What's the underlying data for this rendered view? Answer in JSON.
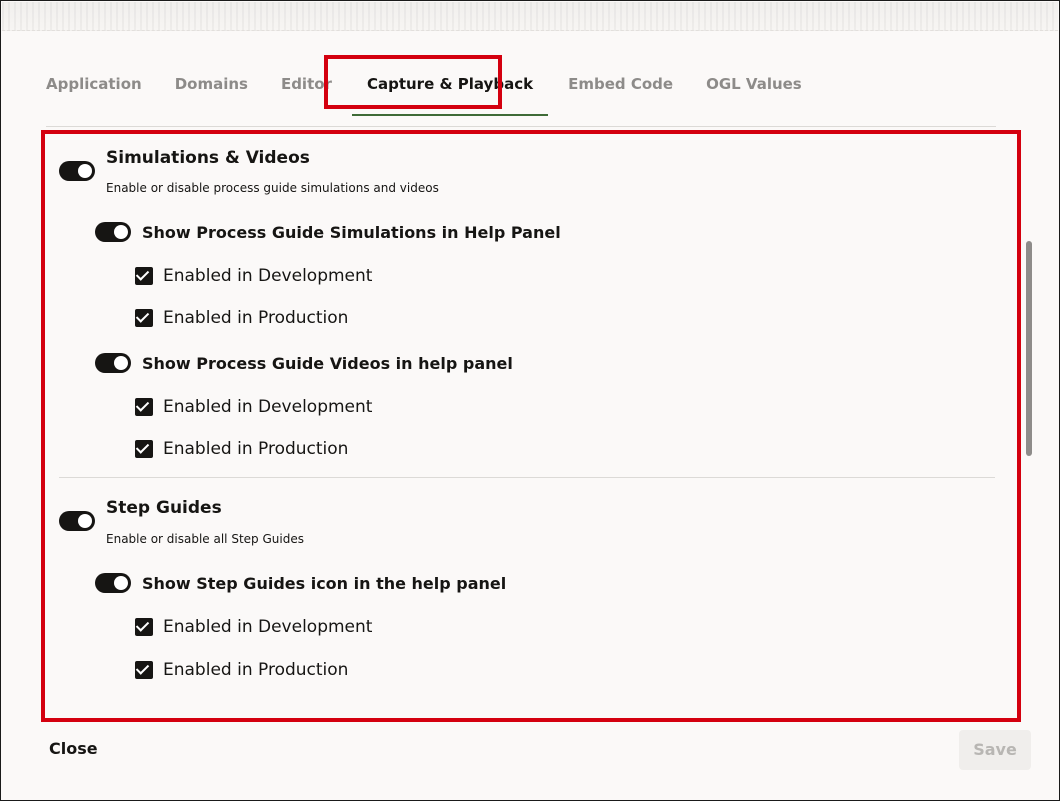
{
  "tabs": [
    {
      "label": "Application"
    },
    {
      "label": "Domains"
    },
    {
      "label": "Editor"
    },
    {
      "label": "Capture & Playback"
    },
    {
      "label": "Embed Code"
    },
    {
      "label": "OGL Values"
    }
  ],
  "active_tab": "Capture & Playback",
  "sections": {
    "simulations": {
      "title": "Simulations & Videos",
      "description": "Enable or disable process guide simulations and videos",
      "enabled": true,
      "simulations_panel": {
        "title": "Show Process Guide Simulations in Help Panel",
        "enabled": true,
        "development_label": "Enabled in Development",
        "development_checked": true,
        "production_label": "Enabled in Production",
        "production_checked": true
      },
      "videos_panel": {
        "title": "Show Process Guide Videos in help panel",
        "enabled": true,
        "development_label": "Enabled in Development",
        "development_checked": true,
        "production_label": "Enabled in Production",
        "production_checked": true
      }
    },
    "step_guides": {
      "title": "Step Guides",
      "description": "Enable or disable all Step Guides",
      "enabled": true,
      "icon_panel": {
        "title": "Show Step Guides icon in the help panel",
        "enabled": true,
        "development_label": "Enabled in Development",
        "development_checked": true,
        "production_label": "Enabled in Production",
        "production_checked": true
      }
    }
  },
  "footer": {
    "close_label": "Close",
    "save_label": "Save"
  },
  "colors": {
    "highlight": "#d4000f",
    "active_tab_underline": "#3f6b37",
    "toggle_on": "#161513",
    "background": "#fbf9f8"
  }
}
